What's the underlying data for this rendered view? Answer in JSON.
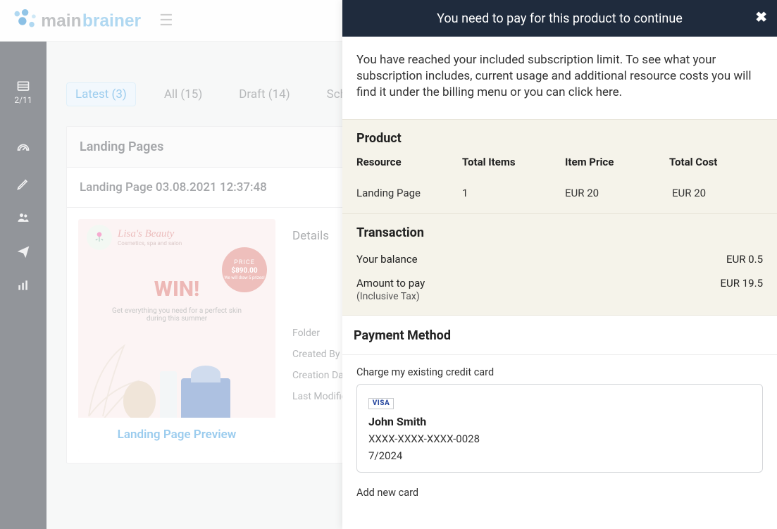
{
  "header": {
    "brand_prefix": "main",
    "brand_suffix": "brainer"
  },
  "sidebar": {
    "counter": "2/11"
  },
  "tabs": [
    {
      "label": "Latest (3)",
      "active": true
    },
    {
      "label": "All (15)",
      "active": false
    },
    {
      "label": "Draft (14)",
      "active": false
    },
    {
      "label": "Scheduled",
      "active": false
    }
  ],
  "panel": {
    "title": "Landing Pages",
    "item_title": "Landing Page 03.08.2021 12:37:48"
  },
  "preview": {
    "brand": "Lisa's Beauty",
    "brand_sub": "Cosmetics, spa and salon",
    "price_label": "PRICE",
    "price_value": "$890.00",
    "price_note": "We will draw 5 prizes!",
    "win": "WIN!",
    "win_sub": "Get everything you need for a perfect skin during this summer",
    "caption": "Landing Page Preview"
  },
  "details": {
    "tab": "Details",
    "rows": [
      {
        "label": "Folder"
      },
      {
        "label": "Created By"
      },
      {
        "label": "Creation Dat"
      },
      {
        "label": "Last Modifie"
      }
    ]
  },
  "modal": {
    "title": "You need to pay for this product to continue",
    "intro": "You have reached your included subscription limit. To see what your subscription includes, current usage and additional resource costs you will find it under the billing menu or you can click here.",
    "product": {
      "title": "Product",
      "headers": {
        "resource": "Resource",
        "items": "Total Items",
        "price": "Item Price",
        "cost": "Total Cost"
      },
      "row": {
        "resource": "Landing Page",
        "items": "1",
        "price": "EUR 20",
        "cost": "EUR 20"
      }
    },
    "transaction": {
      "title": "Transaction",
      "balance_label": "Your balance",
      "balance_value": "EUR 0.5",
      "amount_label": "Amount to pay",
      "amount_sub": "(Inclusive Tax)",
      "amount_value": "EUR 19.5"
    },
    "payment": {
      "title": "Payment Method",
      "charge_label": "Charge my existing credit card",
      "card_brand": "VISA",
      "card_name": "John Smith",
      "card_number": "XXXX-XXXX-XXXX-0028",
      "card_expiry": "7/2024",
      "add_new": "Add new card"
    }
  }
}
